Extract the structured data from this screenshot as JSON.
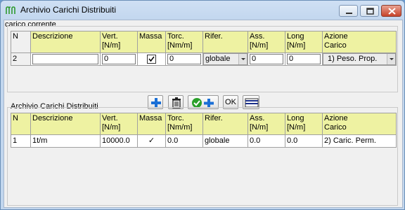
{
  "window": {
    "title": "Archivio Carichi Distribuiti"
  },
  "current": {
    "label": "carico corrente",
    "headers": [
      "N",
      "Descrizione",
      "Vert.\n[N/m]",
      "Massa",
      "Torc.\n[Nm/m]",
      "Rifer.",
      "Ass.\n[N/m]",
      "Long\n[N/m]",
      "Azione\nCarico"
    ],
    "row": {
      "n": "2",
      "descrizione": "",
      "vert": "0",
      "massa_checked": true,
      "torc": "0",
      "rifer": "globale",
      "ass": "0",
      "long": "0",
      "azione": "1) Peso. Prop."
    }
  },
  "toolbar": {
    "ok_label": "OK"
  },
  "archive": {
    "label": "Archivio Carichi Distribuiti",
    "headers": [
      "N",
      "Descrizione",
      "Vert.\n[N/m]",
      "Massa",
      "Torc.\n[Nm/m]",
      "Rifer.",
      "Ass.\n[N/m]",
      "Long\n[N/m]",
      "Azione\nCarico"
    ],
    "rows": [
      {
        "n": "1",
        "descrizione": "1t/m",
        "vert": "10000.0",
        "massa": "✓",
        "torc": "0.0",
        "rifer": "globale",
        "ass": "0.0",
        "long": "0.0",
        "azione": "2) Caric. Perm."
      }
    ]
  },
  "colors": {
    "header_bg": "#eef2a2",
    "titlebar": "#c2d6ee",
    "close_btn": "#c7432a",
    "add_icon": "#1a6fd6",
    "confirm_icon": "#2aa02a"
  },
  "icons": [
    "app-icon",
    "add-icon",
    "trash-icon",
    "confirm-add-icon",
    "list-icon"
  ]
}
